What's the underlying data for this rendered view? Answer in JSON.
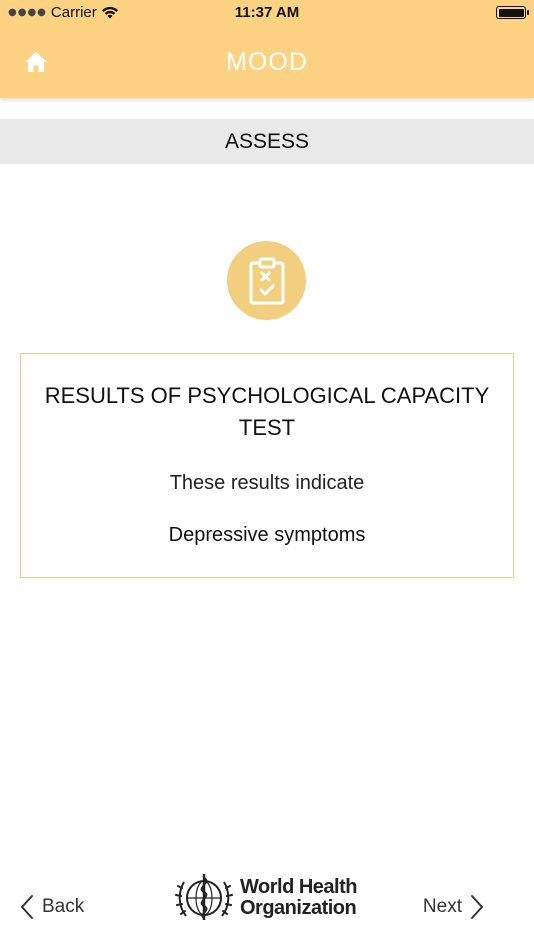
{
  "status_bar": {
    "carrier": "Carrier",
    "time": "11:37 AM"
  },
  "nav": {
    "title": "MOOD",
    "home_icon": "home-icon"
  },
  "section": {
    "title": "ASSESS"
  },
  "badge": {
    "icon": "clipboard-check-icon"
  },
  "card": {
    "title": "RESULTS OF PSYCHOLOGICAL CAPACITY TEST",
    "subtitle": "These results indicate",
    "result": "Depressive symptoms"
  },
  "footer": {
    "back_label": "Back",
    "next_label": "Next",
    "org_line1": "World Health",
    "org_line2": "Organization"
  },
  "colors": {
    "header": "#fdd282",
    "badge": "#f2cf7e",
    "card_border": "#f5cf80",
    "section_bar": "#e9e9e9"
  }
}
